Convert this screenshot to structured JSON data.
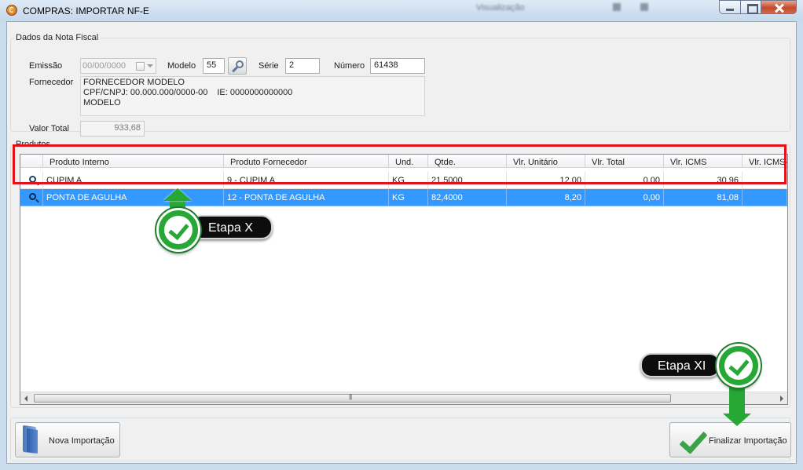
{
  "window": {
    "title": "COMPRAS: IMPORTAR NF-E",
    "blurred_text": "Visualização"
  },
  "nota": {
    "legend": "Dados da Nota Fiscal",
    "emissao_label": "Emissão",
    "emissao_value": "00/00/0000",
    "modelo_label": "Modelo",
    "modelo_value": "55",
    "serie_label": "Série",
    "serie_value": "2",
    "numero_label": "Número",
    "numero_value": "61438",
    "fornecedor_label": "Fornecedor",
    "fornecedor_line1": "FORNECEDOR MODELO",
    "fornecedor_cpf": "CPF/CNPJ: 00.000.000/0000-00",
    "fornecedor_ie": "IE: 0000000000000",
    "fornecedor_line3": "MODELO",
    "valor_total_label": "Valor Total",
    "valor_total_value": "933,68"
  },
  "produtos": {
    "legend": "Produtos",
    "columns": [
      "",
      "Produto Interno",
      "Produto Fornecedor",
      "Und.",
      "Qtde.",
      "Vlr. Unitário",
      "Vlr. Total",
      "Vlr. ICMS",
      "Vlr. ICMS-"
    ],
    "rows": [
      {
        "interno": "CUPIM A",
        "fornecedor": "9 - CUPIM A",
        "und": "KG",
        "qtde": "21,5000",
        "unitario": "12,00",
        "total": "0,00",
        "icms": "30,96",
        "icms2": ""
      },
      {
        "interno": "PONTA DE AGULHA",
        "fornecedor": "12 - PONTA DE AGULHA",
        "und": "KG",
        "qtde": "82,4000",
        "unitario": "8,20",
        "total": "0,00",
        "icms": "81,08",
        "icms2": ""
      }
    ]
  },
  "callouts": {
    "etapa_x": "Etapa X",
    "etapa_xi": "Etapa XI"
  },
  "buttons": {
    "nova": "Nova Importação",
    "finalizar": "Finalizar Importação"
  },
  "colors": {
    "selection": "#3399ff",
    "highlight_border": "#e2111a",
    "badge_green": "#27a836"
  }
}
